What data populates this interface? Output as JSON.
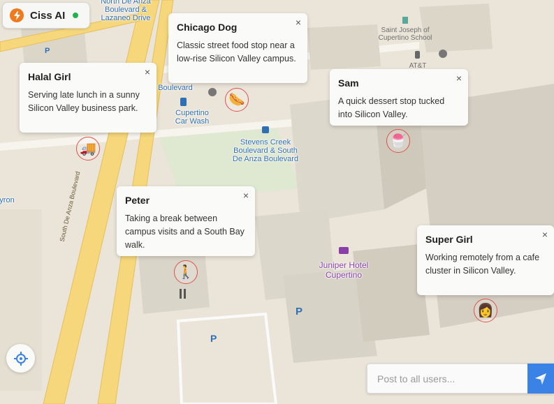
{
  "app": {
    "name": "Ciss AI",
    "logo_icon": "lightning-bolt-icon",
    "status": "online",
    "status_color": "#22b14c",
    "logo_color": "#f07a1e"
  },
  "map_labels": {
    "north_de_anza": "North De Anza Boulevard & Lazaneo Drive",
    "saint_joseph": "Saint Joseph of Cupertino School",
    "att": "AT&T",
    "de_anza_frag": "n De Anza Boulevard",
    "de_anza_frag_short": "Boulevard",
    "cupertino_car_wash": "Cupertino Car Wash",
    "stevens_creek": "Stevens Creek Boulevard & South De Anza Boulevard",
    "juniper_hotel": "Juniper Hotel Cupertino",
    "south_de_anza_road": "South De Anza Boulevard",
    "left_edge": "yron"
  },
  "users": [
    {
      "name": "Chicago Dog",
      "message": "Classic street food stop near a low-rise Silicon Valley campus.",
      "avatar": "hot-dog-icon",
      "avatar_glyph": "🌭"
    },
    {
      "name": "Halal Girl",
      "message": "Serving late lunch in a sunny Silicon Valley business park.",
      "avatar": "food-truck-icon",
      "avatar_glyph": "🚚"
    },
    {
      "name": "Sam",
      "message": "A quick dessert stop tucked into Silicon Valley.",
      "avatar": "dessert-icon",
      "avatar_glyph": "🍧"
    },
    {
      "name": "Peter",
      "message": "Taking a break between campus visits and a South Bay walk.",
      "avatar": "walking-person-icon",
      "avatar_glyph": "🚶"
    },
    {
      "name": "Super Girl",
      "message": "Working remotely from a cafe cluster in Silicon Valley.",
      "avatar": "woman-avatar-icon",
      "avatar_glyph": "👩"
    }
  ],
  "close_glyph": "×",
  "composer": {
    "placeholder": "Post to all users...",
    "send_icon": "send-icon"
  },
  "locate_icon": "crosshair-icon",
  "colors": {
    "accent": "#3b82e6",
    "marker_ring": "#e0504a",
    "road": "#f6d77b",
    "park": "#dfe8d0"
  }
}
